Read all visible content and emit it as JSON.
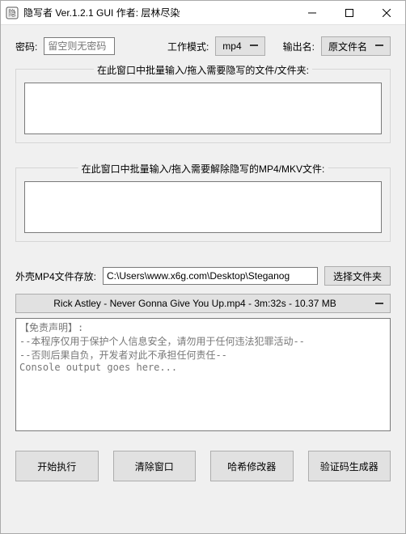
{
  "window": {
    "title": "隐写者 Ver.1.2.1 GUI 作者: 层林尽染"
  },
  "row1": {
    "password_label": "密码:",
    "password_placeholder": "留空则无密码",
    "workmode_label": "工作模式:",
    "workmode_value": "mp4",
    "outname_label": "输出名:",
    "outname_value": "原文件名"
  },
  "group1": {
    "label": "在此窗口中批量输入/拖入需要隐写的文件/文件夹:"
  },
  "group2": {
    "label": "在此窗口中批量输入/拖入需要解除隐写的MP4/MKV文件:"
  },
  "path_row": {
    "label": "外壳MP4文件存放:",
    "value": "C:\\Users\\www.x6g.com\\Desktop\\Steganog",
    "choose_label": "选择文件夹"
  },
  "file_select": {
    "value": "Rick Astley - Never Gonna Give You Up.mp4 - 3m:32s - 10.37 MB"
  },
  "console": {
    "text": "【免责声明】:\n--本程序仅用于保护个人信息安全，请勿用于任何违法犯罪活动--\n--否则后果自负，开发者对此不承担任何责任--\nConsole output goes here..."
  },
  "buttons": {
    "start": "开始执行",
    "clear": "清除窗口",
    "hash": "哈希修改器",
    "verify": "验证码生成器"
  }
}
